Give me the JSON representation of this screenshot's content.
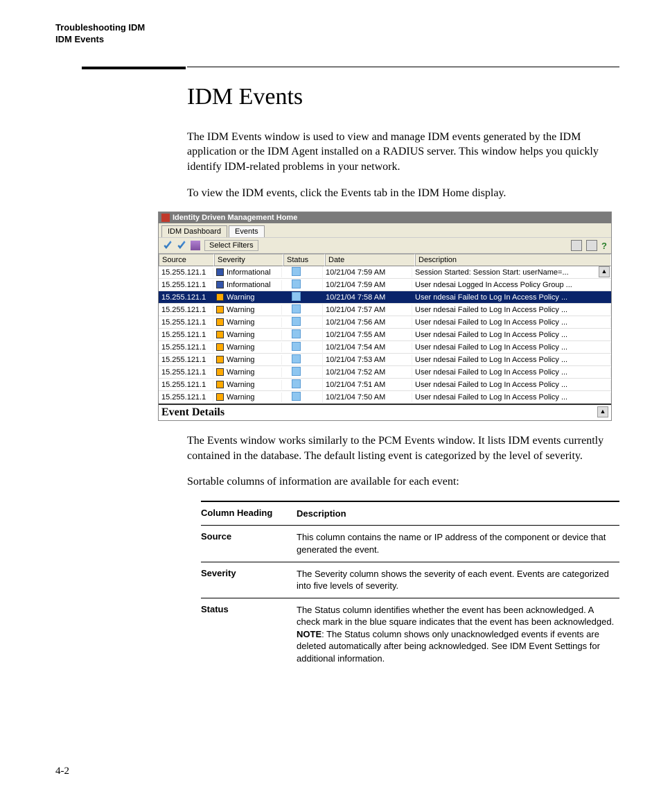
{
  "header": {
    "line1": "Troubleshooting IDM",
    "line2": "IDM Events"
  },
  "title": "IDM Events",
  "para1": "The IDM Events window is used to view and manage IDM events generated by the IDM application or the IDM Agent installed on a RADIUS server. This window helps you quickly identify IDM-related problems in your network.",
  "para2": "To view the IDM events, click the Events tab in the IDM Home display.",
  "screenshot": {
    "window_title": "Identity Driven Management Home",
    "tabs": [
      "IDM Dashboard",
      "Events"
    ],
    "active_tab": 1,
    "filter_button": "Select Filters",
    "columns": [
      "Source",
      "Severity",
      "Status",
      "Date",
      "Description"
    ],
    "rows": [
      {
        "source": "15.255.121.1",
        "severity": "Informational",
        "sev_color": "info",
        "date": "10/21/04 7:59 AM",
        "desc": "Session Started: Session Start: userName=...",
        "selected": false
      },
      {
        "source": "15.255.121.1",
        "severity": "Informational",
        "sev_color": "info",
        "date": "10/21/04 7:59 AM",
        "desc": "User ndesai Logged In Access Policy Group ...",
        "selected": false
      },
      {
        "source": "15.255.121.1",
        "severity": "Warning",
        "sev_color": "warn",
        "date": "10/21/04 7:58 AM",
        "desc": "User ndesai Failed to Log In Access Policy ...",
        "selected": true
      },
      {
        "source": "15.255.121.1",
        "severity": "Warning",
        "sev_color": "warn",
        "date": "10/21/04 7:57 AM",
        "desc": "User ndesai Failed to Log In Access Policy ...",
        "selected": false
      },
      {
        "source": "15.255.121.1",
        "severity": "Warning",
        "sev_color": "warn",
        "date": "10/21/04 7:56 AM",
        "desc": "User ndesai Failed to Log In Access Policy ...",
        "selected": false
      },
      {
        "source": "15.255.121.1",
        "severity": "Warning",
        "sev_color": "warn",
        "date": "10/21/04 7:55 AM",
        "desc": "User ndesai Failed to Log In Access Policy ...",
        "selected": false
      },
      {
        "source": "15.255.121.1",
        "severity": "Warning",
        "sev_color": "warn",
        "date": "10/21/04 7:54 AM",
        "desc": "User ndesai Failed to Log In Access Policy ...",
        "selected": false
      },
      {
        "source": "15.255.121.1",
        "severity": "Warning",
        "sev_color": "warn",
        "date": "10/21/04 7:53 AM",
        "desc": "User ndesai Failed to Log In Access Policy ...",
        "selected": false
      },
      {
        "source": "15.255.121.1",
        "severity": "Warning",
        "sev_color": "warn",
        "date": "10/21/04 7:52 AM",
        "desc": "User ndesai Failed to Log In Access Policy ...",
        "selected": false
      },
      {
        "source": "15.255.121.1",
        "severity": "Warning",
        "sev_color": "warn",
        "date": "10/21/04 7:51 AM",
        "desc": "User ndesai Failed to Log In Access Policy ...",
        "selected": false
      },
      {
        "source": "15.255.121.1",
        "severity": "Warning",
        "sev_color": "warn",
        "date": "10/21/04 7:50 AM",
        "desc": "User ndesai Failed to Log In Access Policy ...",
        "selected": false
      }
    ],
    "details_caption": "Event Details"
  },
  "para3": "The Events window works similarly to the PCM Events window. It lists IDM events currently contained in the database. The default listing event is categorized by the level of severity.",
  "para4": "Sortable columns of information are available for each event:",
  "desc_table": {
    "headers": {
      "c1": "Column Heading",
      "c2": "Description"
    },
    "rows": [
      {
        "c1": "Source",
        "c2": "This column contains the name or IP address of the component or device that generated the event."
      },
      {
        "c1": "Severity",
        "c2": "The Severity column shows the severity of each event. Events are categorized into five levels of severity."
      },
      {
        "c1": "Status",
        "c2_pre": "The Status column identifies whether the event has been acknowledged. A check mark in the blue square indicates that the event has been acknowledged.",
        "c2_note_label": "NOTE",
        "c2_note": ": The Status column shows only unacknowledged events if events are deleted automatically after being acknowledged. See IDM Event Settings for additional information."
      }
    ]
  },
  "page_number": "4-2"
}
